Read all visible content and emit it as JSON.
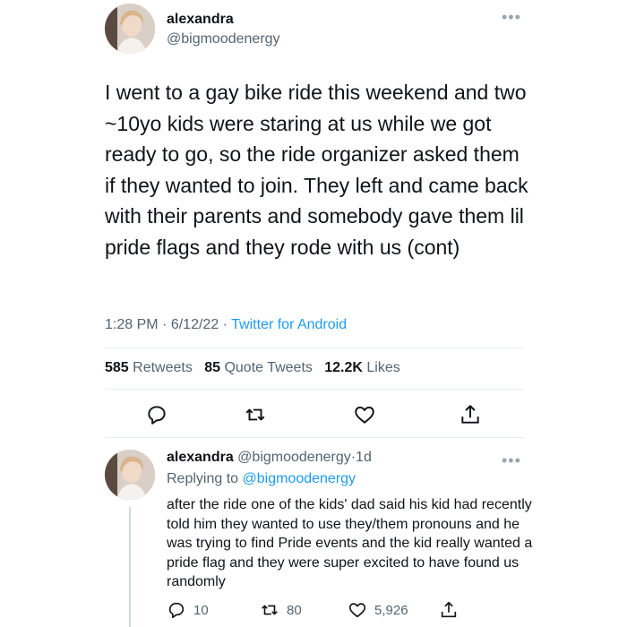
{
  "main_tweet": {
    "author_name": "alexandra",
    "author_handle": "@bigmoodenergy",
    "text": "I went to a gay bike ride this weekend and two ~10yo kids were staring at us while we got ready to go, so the ride organizer asked them if they wanted to join. They left and came back with their parents and somebody gave them lil pride flags and they rode with us (cont)",
    "time": "1:28 PM",
    "date": "6/12/22",
    "sep": "·",
    "source": "Twitter for Android",
    "retweets_count": "585",
    "retweets_label": "Retweets",
    "quotes_count": "85",
    "quotes_label": "Quote Tweets",
    "likes_count": "12.2K",
    "likes_label": "Likes"
  },
  "reply_tweet": {
    "author_name": "alexandra",
    "author_handle": "@bigmoodenergy",
    "age": "1d",
    "sep": "·",
    "replying_prefix": "Replying to",
    "replying_handle": "@bigmoodenergy",
    "text": "after the ride one of the kids' dad said his kid had recently told him they wanted to use they/them pronouns and he was trying to find Pride events and the kid really wanted a pride flag and they were super excited to have found us randomly",
    "reply_count": "10",
    "retweet_count": "80",
    "like_count": "5,926"
  },
  "icons": {
    "more": "more-icon",
    "reply": "reply-icon",
    "retweet": "retweet-icon",
    "like": "heart-icon",
    "share": "share-icon"
  },
  "colors": {
    "link": "#1d9bf0",
    "muted": "#536471",
    "divider": "#e6ecf0"
  }
}
